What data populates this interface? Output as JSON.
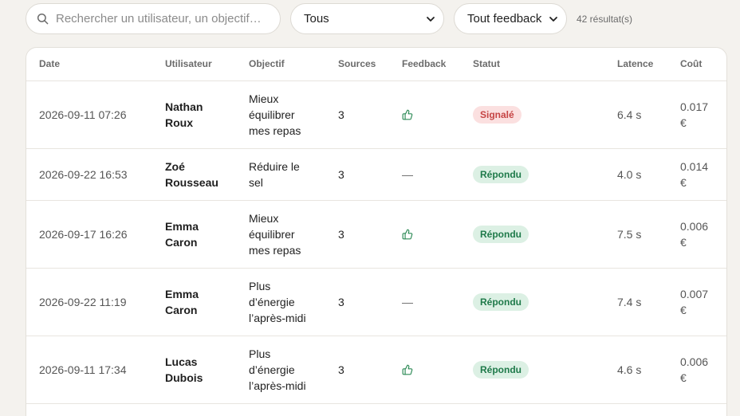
{
  "toolbar": {
    "search_placeholder": "Rechercher un utilisateur, un objectif…",
    "status_filter": "Tous",
    "feedback_filter": "Tout feedback",
    "result_count": "42 résultat(s)"
  },
  "table": {
    "headers": {
      "date": "Date",
      "user": "Utilisateur",
      "goal": "Objectif",
      "sources": "Sources",
      "feedback": "Feedback",
      "status": "Statut",
      "latency": "Latence",
      "cost": "Coût"
    },
    "rows": [
      {
        "date": "2026-09-11 07:26",
        "user": "Nathan Roux",
        "goal": "Mieux équilibrer mes repas",
        "sources": "3",
        "feedback": "thumbs-up",
        "status": "Signalé",
        "status_kind": "red",
        "latency": "6.4 s",
        "cost": "0.017 €"
      },
      {
        "date": "2026-09-22 16:53",
        "user": "Zoé Rousseau",
        "goal": "Réduire le sel",
        "sources": "3",
        "feedback": "—",
        "status": "Répondu",
        "status_kind": "green",
        "latency": "4.0 s",
        "cost": "0.014 €"
      },
      {
        "date": "2026-09-17 16:26",
        "user": "Emma Caron",
        "goal": "Mieux équilibrer mes repas",
        "sources": "3",
        "feedback": "thumbs-up",
        "status": "Répondu",
        "status_kind": "green",
        "latency": "7.5 s",
        "cost": "0.006 €"
      },
      {
        "date": "2026-09-22 11:19",
        "user": "Emma Caron",
        "goal": "Plus d’énergie l’après-midi",
        "sources": "3",
        "feedback": "—",
        "status": "Répondu",
        "status_kind": "green",
        "latency": "7.4 s",
        "cost": "0.007 €"
      },
      {
        "date": "2026-09-11 17:34",
        "user": "Lucas Dubois",
        "goal": "Plus d’énergie l’après-midi",
        "sources": "3",
        "feedback": "thumbs-up",
        "status": "Répondu",
        "status_kind": "green",
        "latency": "4.6 s",
        "cost": "0.006 €"
      }
    ]
  },
  "colors": {
    "background": "#f4f2ee",
    "signale_bg": "#fbe0e0",
    "signale_text": "#c64444",
    "repondu_bg": "#dcf0e4",
    "repondu_text": "#1f7a4a",
    "thumb_icon": "#2e8b57"
  }
}
